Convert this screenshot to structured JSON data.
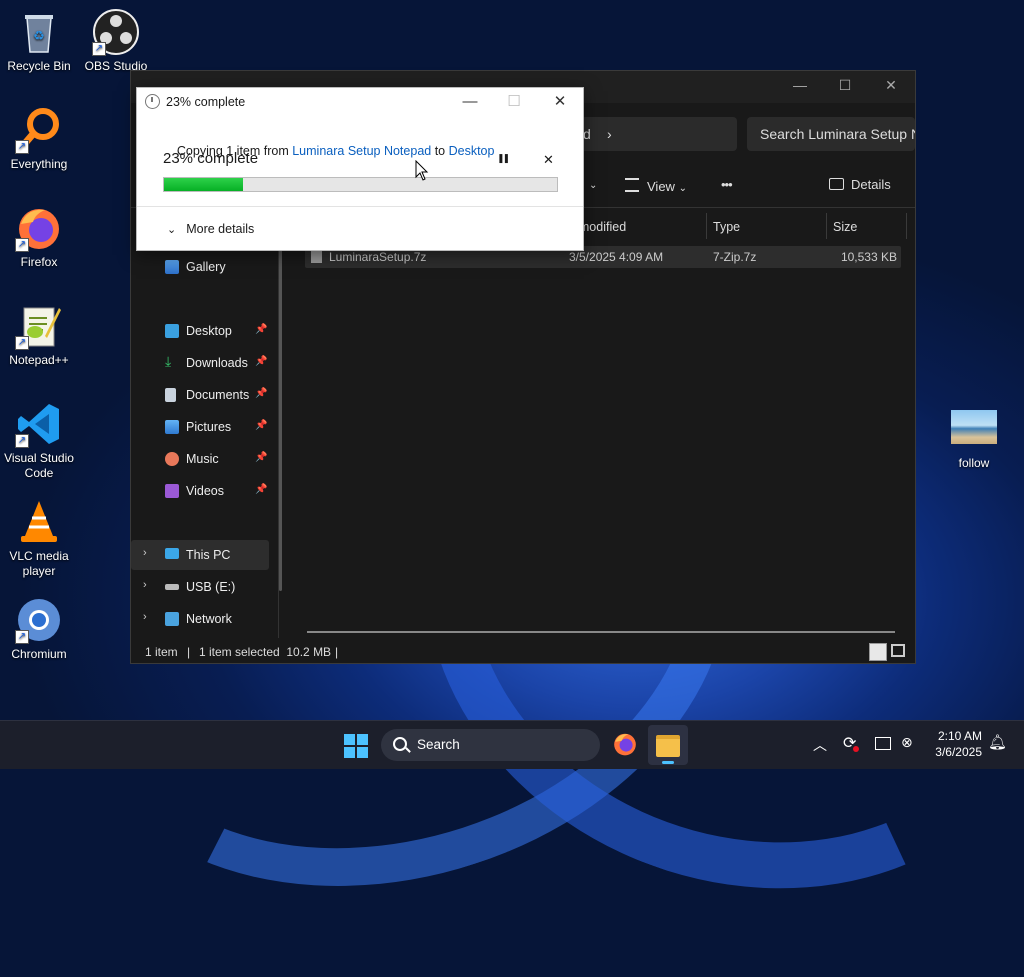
{
  "desktop": {
    "icons": [
      {
        "label": "Recycle Bin",
        "icon": "recycle-bin-icon"
      },
      {
        "label": "OBS Studio",
        "icon": "obs-icon"
      },
      {
        "label": "Everything",
        "icon": "everything-icon"
      },
      {
        "label": "Firefox",
        "icon": "firefox-icon"
      },
      {
        "label": "Notepad++",
        "icon": "notepadpp-icon"
      },
      {
        "label": "Visual Studio Code",
        "icon": "vscode-icon"
      },
      {
        "label": "VLC media player",
        "icon": "vlc-icon"
      },
      {
        "label": "Chromium",
        "icon": "chromium-icon"
      },
      {
        "label": "follow",
        "icon": "image-file-icon"
      }
    ]
  },
  "explorer": {
    "title_controls": {
      "minimize": "—",
      "maximize": "☐",
      "close": "✕"
    },
    "address_tail": "d",
    "address_chevron": "›",
    "search_placeholder": "Search Luminara Setup N",
    "toolbar": {
      "view_label": "View",
      "details_label": "Details",
      "more": "•••"
    },
    "nav": [
      {
        "label": "Gallery",
        "pinned": false
      },
      {
        "label": "Desktop",
        "pinned": true
      },
      {
        "label": "Downloads",
        "pinned": true
      },
      {
        "label": "Documents",
        "pinned": true
      },
      {
        "label": "Pictures",
        "pinned": true
      },
      {
        "label": "Music",
        "pinned": true
      },
      {
        "label": "Videos",
        "pinned": true
      },
      {
        "label": "This PC",
        "expandable": true
      },
      {
        "label": "USB (E:)",
        "expandable": true
      },
      {
        "label": "Network",
        "expandable": true
      }
    ],
    "columns": {
      "date_modified": "te modified",
      "type": "Type",
      "size": "Size"
    },
    "files": [
      {
        "name": "LuminaraSetup.7z",
        "date": "3/5/2025 4:09 AM",
        "type": "7-Zip.7z",
        "size": "10,533 KB"
      }
    ],
    "status": {
      "count": "1 item",
      "selected": "1 item selected  10.2 MB"
    }
  },
  "copy_dialog": {
    "title": "23% complete",
    "copy_prefix": "Copying 1 item from ",
    "source": "Luminara Setup Notepad",
    "to_word": " to ",
    "destination": "Desktop",
    "progress_text": "23% complete",
    "progress_value": 0.2,
    "pause_icon": "❚❚",
    "cancel_icon": "✕",
    "more_details": "More details",
    "controls": {
      "minimize": "—",
      "maximize": "☐",
      "close": "✕"
    }
  },
  "taskbar": {
    "search_label": "Search",
    "time": "2:10 AM",
    "date": "3/6/2025"
  },
  "colors": {
    "accent": "#0a5fbf",
    "progress_green": "#06b025",
    "explorer_bg": "#191919"
  }
}
